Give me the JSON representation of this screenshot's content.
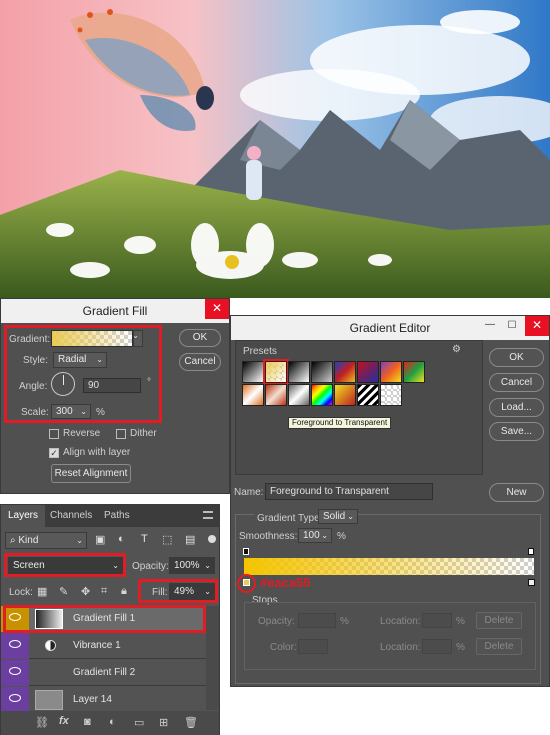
{
  "gradient_fill": {
    "title": "Gradient Fill",
    "close": "✕",
    "gradient_label": "Gradient:",
    "style_label": "Style:",
    "style_value": "Radial",
    "angle_label": "Angle:",
    "angle_value": "90",
    "angle_unit": "°",
    "scale_label": "Scale:",
    "scale_value": "300",
    "scale_unit": "%",
    "reverse_label": "Reverse",
    "dither_label": "Dither",
    "align_label": "Align with layer",
    "reset_label": "Reset Alignment",
    "ok_label": "OK",
    "cancel_label": "Cancel"
  },
  "gradient_editor": {
    "title": "Gradient Editor",
    "minimize": "—",
    "maximize": "☐",
    "close": "✕",
    "presets_label": "Presets",
    "tooltip": "Foreground to Transparent",
    "ok_label": "OK",
    "cancel_label": "Cancel",
    "load_label": "Load...",
    "save_label": "Save...",
    "name_label": "Name:",
    "name_value": "Foreground to Transparent",
    "new_label": "New",
    "type_label": "Gradient Type:",
    "type_value": "Solid",
    "smooth_label": "Smoothness:",
    "smooth_value": "100",
    "smooth_unit": "%",
    "stop_color_text": "#eaca55",
    "stops_label": "Stops",
    "opacity_label": "Opacity:",
    "opacity_unit": "%",
    "location_label": "Location:",
    "location_unit": "%",
    "delete_label": "Delete",
    "color_label": "Color:",
    "location2_label": "Location:",
    "location2_unit": "%",
    "delete2_label": "Delete"
  },
  "layers": {
    "tabs": [
      "Layers",
      "Channels",
      "Paths"
    ],
    "kind_label": "Kind",
    "blend_mode": "Screen",
    "opacity_label": "Opacity:",
    "opacity_value": "100%",
    "lock_label": "Lock:",
    "fill_label": "Fill:",
    "fill_value": "49%",
    "rows": [
      {
        "name": "Gradient Fill 1"
      },
      {
        "name": "Vibrance 1"
      },
      {
        "name": "Gradient Fill 2"
      },
      {
        "name": "Layer 14"
      }
    ]
  },
  "colors": {
    "accent_red": "#e01c24",
    "gradient_start": "#eaca55",
    "eye_purple": "#6b3fa0",
    "eye_selected": "#c79100"
  }
}
